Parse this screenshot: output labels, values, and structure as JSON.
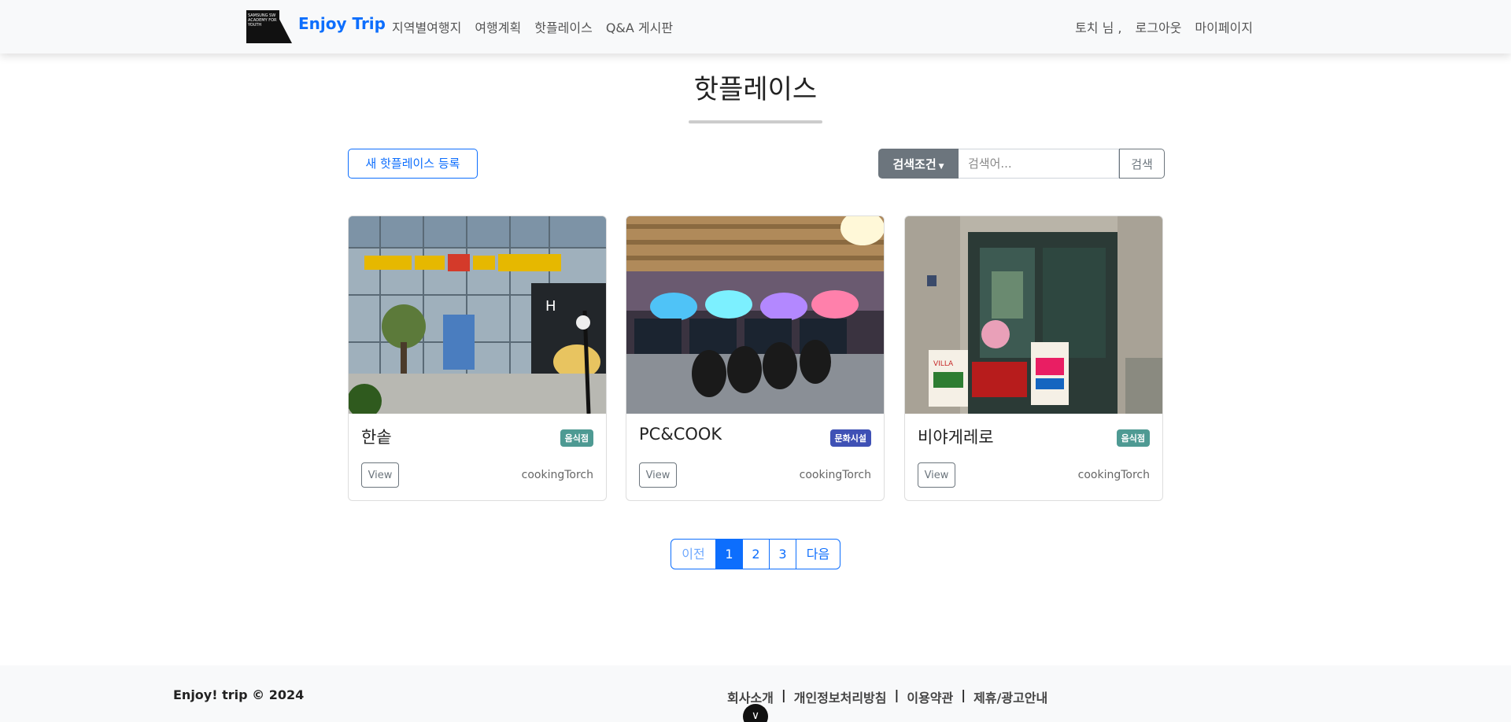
{
  "navbar": {
    "brand": "Enjoy Trip",
    "logo_text": "SAMSUNG SW ACADEMY FOR YOUTH",
    "menu": [
      "지역별여행지",
      "여행계획",
      "핫플레이스",
      "Q&A 게시판"
    ],
    "user_greeting": "토치 님 ,",
    "logout": "로그아웃",
    "mypage": "마이페이지"
  },
  "page": {
    "title": "핫플레이스"
  },
  "actions": {
    "register_label": "새 핫플레이스 등록",
    "search_condition_label": "검색조건",
    "search_placeholder": "검색어...",
    "search_button_label": "검색"
  },
  "cards": [
    {
      "title": "한솥",
      "badge": "음식점",
      "badge_color": "#4e9a93",
      "view_label": "View",
      "author": "cookingTorch"
    },
    {
      "title": "PC&COOK",
      "badge": "문화시설",
      "badge_color": "#3f51b5",
      "view_label": "View",
      "author": "cookingTorch"
    },
    {
      "title": "비야게레로",
      "badge": "음식점",
      "badge_color": "#4e9a93",
      "view_label": "View",
      "author": "cookingTorch"
    }
  ],
  "pagination": {
    "prev": "이전",
    "pages": [
      "1",
      "2",
      "3"
    ],
    "current": "1",
    "next": "다음"
  },
  "footer": {
    "brand": "Enjoy! trip © 2024",
    "links": [
      "회사소개",
      "개인정보처리방침",
      "이용약관",
      "제휴/광고안내"
    ],
    "separator": "|"
  },
  "colors": {
    "primary": "#0d6efd",
    "secondary": "#6c757d",
    "navbar_bg": "#f8f9fa"
  }
}
